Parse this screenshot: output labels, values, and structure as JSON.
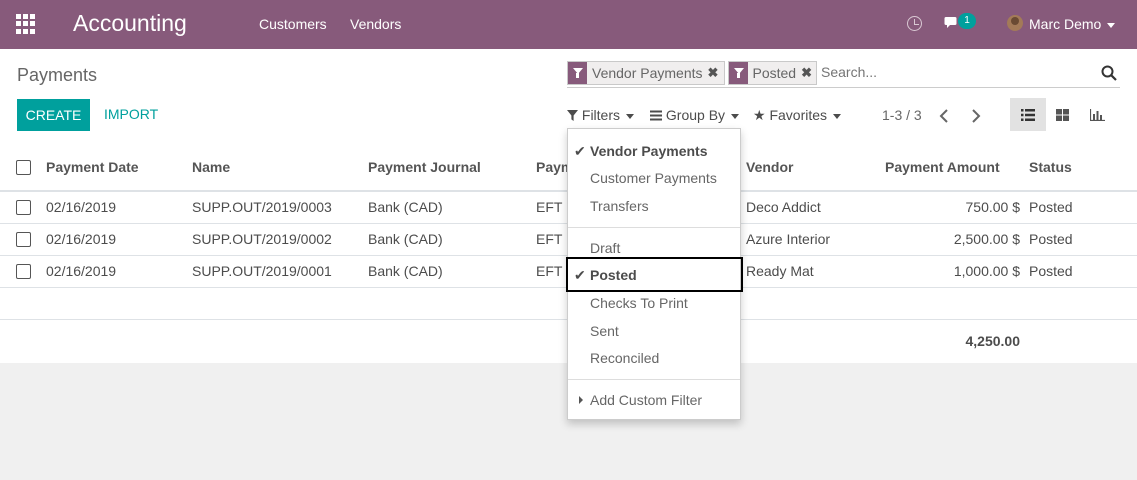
{
  "navbar": {
    "app_title": "Accounting",
    "menu": [
      "Customers",
      "Vendors"
    ],
    "message_count": "1",
    "user_name": "Marc Demo",
    "color": "#875a7b"
  },
  "control": {
    "page_title": "Payments",
    "create_label": "CREATE",
    "import_label": "IMPORT",
    "facets": [
      "Vendor Payments",
      "Posted"
    ],
    "search_placeholder": "Search...",
    "filters_label": "Filters",
    "groupby_label": "Group By",
    "favorites_label": "Favorites",
    "pager": "1-3 / 3",
    "accent": "#00a09d"
  },
  "table": {
    "headers": [
      "Payment Date",
      "Name",
      "Payment Journal",
      "Payment Method",
      "Vendor",
      "Payment Amount",
      "Status"
    ],
    "rows": [
      {
        "date": "02/16/2019",
        "name": "SUPP.OUT/2019/0003",
        "journal": "Bank (CAD)",
        "method": "EFT",
        "vendor": "Deco Addict",
        "amount": "750.00 $",
        "status": "Posted"
      },
      {
        "date": "02/16/2019",
        "name": "SUPP.OUT/2019/0002",
        "journal": "Bank (CAD)",
        "method": "EFT",
        "vendor": "Azure Interior",
        "amount": "2,500.00 $",
        "status": "Posted"
      },
      {
        "date": "02/16/2019",
        "name": "SUPP.OUT/2019/0001",
        "journal": "Bank (CAD)",
        "method": "EFT",
        "vendor": "Ready Mat",
        "amount": "1,000.00 $",
        "status": "Posted"
      }
    ],
    "total": "4,250.00"
  },
  "filters_dropdown": {
    "items": [
      {
        "label": "Vendor Payments",
        "selected": true
      },
      {
        "label": "Customer Payments",
        "selected": false
      },
      {
        "label": "Transfers",
        "selected": false
      },
      {
        "label": "Draft",
        "selected": false
      },
      {
        "label": "Posted",
        "selected": true
      },
      {
        "label": "Checks To Print",
        "selected": false
      },
      {
        "label": "Sent",
        "selected": false
      },
      {
        "label": "Reconciled",
        "selected": false
      }
    ],
    "custom_filter_label": "Add Custom Filter"
  }
}
